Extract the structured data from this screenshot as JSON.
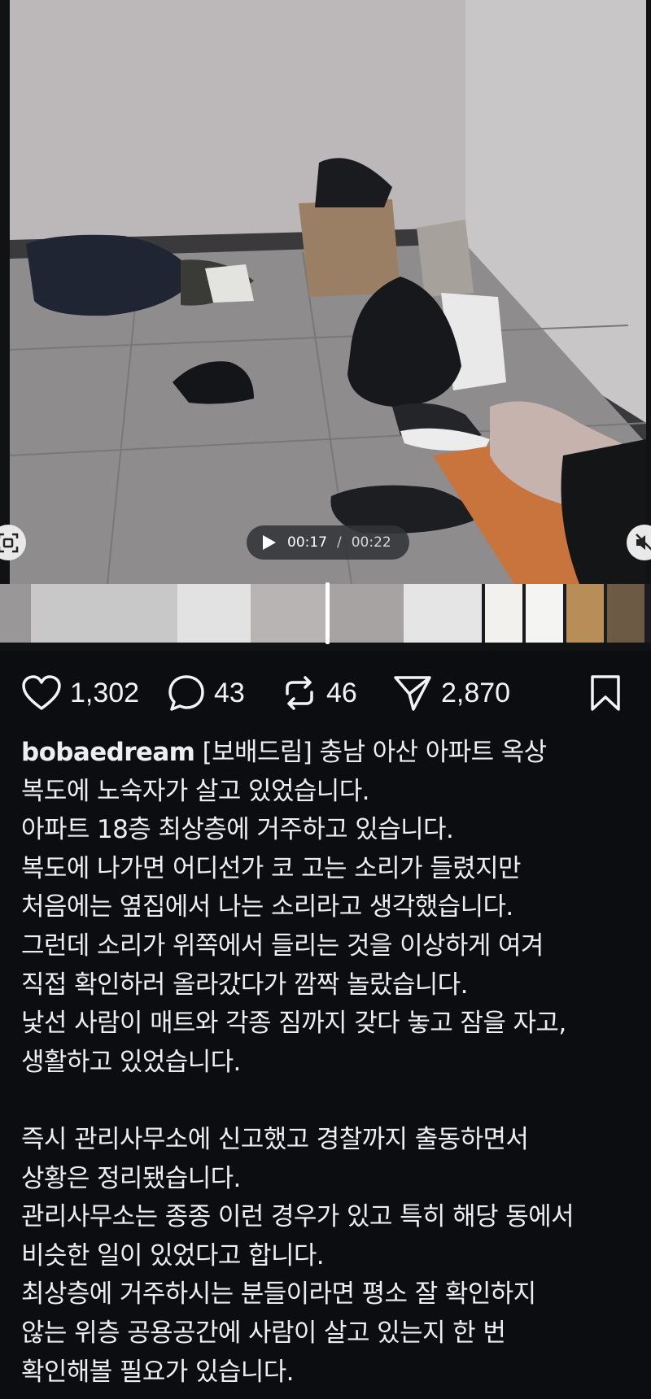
{
  "video": {
    "current_time": "00:17",
    "separator": "/",
    "total_time": "00:22",
    "play_icon": "play-icon",
    "left_button_icon": "screen-capture-icon",
    "right_button_icon": "mute-icon"
  },
  "actions": {
    "likes": "1,302",
    "comments": "43",
    "reposts": "46",
    "shares": "2,870",
    "like_icon": "heart-icon",
    "comment_icon": "comment-bubble-icon",
    "repost_icon": "repost-icon",
    "share_icon": "send-icon",
    "save_icon": "bookmark-icon"
  },
  "post": {
    "username": "bobaedream",
    "lines": [
      "[보배드림] 충남 아산 아파트 옥상",
      "복도에 노숙자가 살고 있었습니다.",
      "아파트 18층 최상층에 거주하고 있습니다.",
      "복도에 나가면 어디선가 코 고는 소리가 들렸지만",
      "처음에는 옆집에서 나는 소리라고 생각했습니다.",
      "그런데 소리가 위쪽에서 들리는 것을 이상하게 여겨",
      "직접 확인하러 올라갔다가 깜짝 놀랐습니다.",
      "낯선 사람이 매트와 각종 짐까지 갖다 놓고 잠을 자고,",
      "생활하고 있었습니다.",
      "",
      "즉시 관리사무소에 신고했고 경찰까지 출동하면서",
      "상황은 정리됐습니다.",
      "관리사무소는 종종 이런 경우가 있고 특히 해당 동에서",
      "비슷한 일이 있었다고 합니다.",
      "최상층에 거주하시는 분들이라면 평소 잘 확인하지",
      "않는 위층 공용공간에 사람이 살고 있는지 한 번",
      "확인해볼 필요가 있습니다."
    ]
  }
}
